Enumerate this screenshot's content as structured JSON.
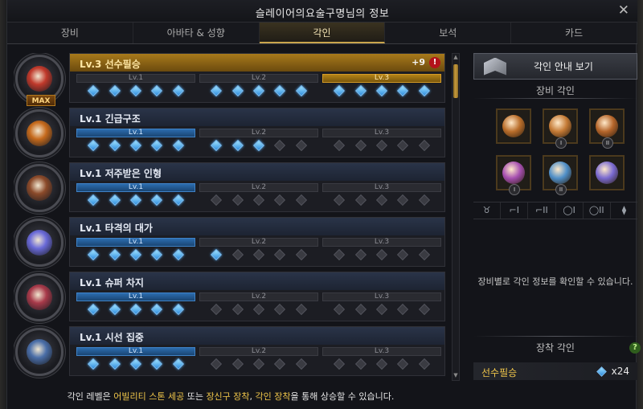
{
  "window": {
    "title": "슬레이어의요술구명님의 정보",
    "close": "✕"
  },
  "tabs": [
    {
      "label": "장비",
      "active": false
    },
    {
      "label": "아바타 & 성향",
      "active": false
    },
    {
      "label": "각인",
      "active": true
    },
    {
      "label": "보석",
      "active": false
    },
    {
      "label": "카드",
      "active": false
    }
  ],
  "engravings": [
    {
      "title": "Lv.3 선수필승",
      "gold": true,
      "max": "MAX",
      "bonus": "+9",
      "warn": "!",
      "levels": [
        {
          "label": "Lv.1",
          "state": "gem"
        },
        {
          "label": "Lv.2",
          "state": "gem"
        },
        {
          "label": "Lv.3",
          "state": "gold"
        }
      ],
      "active_gems": 15,
      "color": "#c0392b"
    },
    {
      "title": "Lv.1 긴급구조",
      "gold": false,
      "levels": [
        {
          "label": "Lv.1",
          "state": "on"
        },
        {
          "label": "Lv.2",
          "state": "off"
        },
        {
          "label": "Lv.3",
          "state": "off"
        }
      ],
      "active_gems": 8,
      "color": "#c66a1c"
    },
    {
      "title": "Lv.1 저주받은 인형",
      "gold": false,
      "levels": [
        {
          "label": "Lv.1",
          "state": "on"
        },
        {
          "label": "Lv.2",
          "state": "off"
        },
        {
          "label": "Lv.3",
          "state": "off"
        }
      ],
      "active_gems": 5,
      "color": "#8b4a2a"
    },
    {
      "title": "Lv.1 타격의 대가",
      "gold": false,
      "levels": [
        {
          "label": "Lv.1",
          "state": "on"
        },
        {
          "label": "Lv.2",
          "state": "off"
        },
        {
          "label": "Lv.3",
          "state": "off"
        }
      ],
      "active_gems": 6,
      "color": "#6a6ad8"
    },
    {
      "title": "Lv.1 슈퍼 차지",
      "gold": false,
      "levels": [
        {
          "label": "Lv.1",
          "state": "on"
        },
        {
          "label": "Lv.2",
          "state": "off"
        },
        {
          "label": "Lv.3",
          "state": "off"
        }
      ],
      "active_gems": 5,
      "color": "#a83a4a"
    },
    {
      "title": "Lv.1 시선 집중",
      "gold": false,
      "levels": [
        {
          "label": "Lv.1",
          "state": "on"
        },
        {
          "label": "Lv.2",
          "state": "off"
        },
        {
          "label": "Lv.3",
          "state": "off"
        }
      ],
      "active_gems": 5,
      "color": "#4a6ea8"
    }
  ],
  "footnote": {
    "prefix": "각인 레벨은 ",
    "hl1": "어빌리티 스톤 세공",
    "mid1": " 또는 ",
    "hl2": "장신구 장착",
    "mid2": ", ",
    "hl3": "각인 장착",
    "suffix": "을 통해 상승할 수 있습니다."
  },
  "right_panel": {
    "guide_button": "각인 안내 보기",
    "equip_title": "장비 각인",
    "slots": [
      {
        "name": "necklace-slot",
        "tag": "",
        "color": "#b96d2a"
      },
      {
        "name": "earring-1-slot",
        "tag": "I",
        "color": "#c47a35"
      },
      {
        "name": "earring-2-slot",
        "tag": "II",
        "color": "#b5652a"
      },
      {
        "name": "ring-1-slot",
        "tag": "I",
        "color": "#a64fb0"
      },
      {
        "name": "ring-2-slot",
        "tag": "II",
        "color": "#4f8fc8"
      },
      {
        "name": "stone-slot",
        "tag": "",
        "color": "#7a6ad0"
      }
    ],
    "slot_icons": [
      "♉",
      "⌐I",
      "⌐II",
      "◯I",
      "◯II",
      "⧫"
    ],
    "hint": "장비별로 각인 정보를 확인할 수 있습니다.",
    "equipped_title": "장착 각인",
    "help": "?",
    "equipped": {
      "name": "선수필승",
      "count": "x24"
    }
  }
}
